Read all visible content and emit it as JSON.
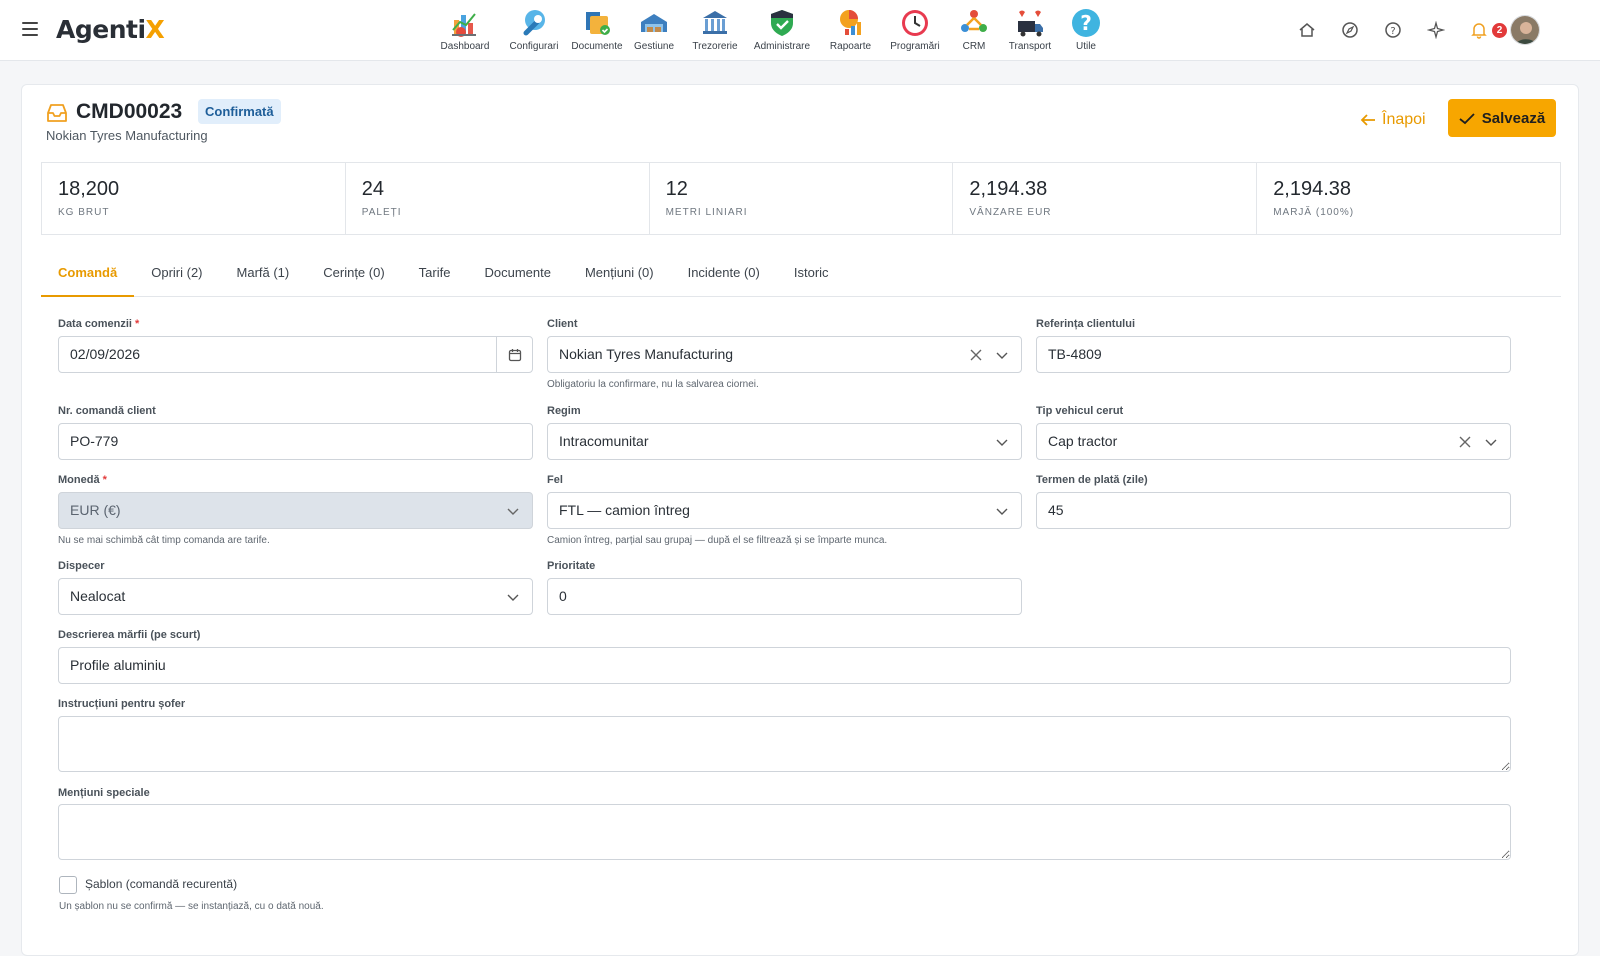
{
  "app": {
    "logo_main": "Agenti",
    "logo_accent": "X",
    "notifications_count": "2"
  },
  "nav": [
    {
      "label": "Dashboard",
      "icon": "dashboard-icon"
    },
    {
      "label": "Configurari",
      "icon": "wrench-icon"
    },
    {
      "label": "Documente",
      "icon": "documents-icon"
    },
    {
      "label": "Gestiune",
      "icon": "warehouse-icon"
    },
    {
      "label": "Trezorerie",
      "icon": "bank-icon"
    },
    {
      "label": "Administrare",
      "icon": "shield-icon"
    },
    {
      "label": "Rapoarte",
      "icon": "report-icon"
    },
    {
      "label": "Programări",
      "icon": "clock-icon"
    },
    {
      "label": "CRM",
      "icon": "crm-icon"
    },
    {
      "label": "Transport",
      "icon": "truck-icon"
    },
    {
      "label": "Utile",
      "icon": "help-icon"
    }
  ],
  "header": {
    "order_number": "CMD00023",
    "status": "Confirmată",
    "client_name": "Nokian Tyres Manufacturing",
    "back_label": "Înapoi",
    "save_label": "Salvează"
  },
  "stats": [
    {
      "value": "18,200",
      "label": "KG BRUT"
    },
    {
      "value": "24",
      "label": "PALEȚI"
    },
    {
      "value": "12",
      "label": "METRI LINIARI"
    },
    {
      "value": "2,194.38",
      "label": "VÂNZARE EUR"
    },
    {
      "value": "2,194.38",
      "label": "MARJĂ (100%)"
    }
  ],
  "tabs": [
    {
      "label": "Comandă",
      "active": true
    },
    {
      "label": "Opriri (2)"
    },
    {
      "label": "Marfă (1)"
    },
    {
      "label": "Cerințe (0)"
    },
    {
      "label": "Tarife"
    },
    {
      "label": "Documente"
    },
    {
      "label": "Mențiuni (0)"
    },
    {
      "label": "Incidente (0)"
    },
    {
      "label": "Istoric"
    }
  ],
  "form": {
    "order_date": {
      "label": "Data comenzii",
      "value": "02/09/2026"
    },
    "client": {
      "label": "Client",
      "value": "Nokian Tyres Manufacturing",
      "hint": "Obligatoriu la confirmare, nu la salvarea ciornei."
    },
    "client_ref": {
      "label": "Referința clientului",
      "value": "TB-4809"
    },
    "client_order_no": {
      "label": "Nr. comandă client",
      "value": "PO-779"
    },
    "regime": {
      "label": "Regim",
      "value": "Intracomunitar"
    },
    "vehicle_type": {
      "label": "Tip vehicul cerut",
      "value": "Cap tractor"
    },
    "currency": {
      "label": "Monedă",
      "value": "EUR (€)",
      "hint": "Nu se mai schimbă cât timp comanda are tarife."
    },
    "kind": {
      "label": "Fel",
      "value": "FTL — camion întreg",
      "hint": "Camion întreg, parțial sau grupaj — după el se filtrează și se împarte munca."
    },
    "payment_term": {
      "label": "Termen de plată (zile)",
      "value": "45"
    },
    "dispatcher": {
      "label": "Dispecer",
      "value": "Nealocat"
    },
    "priority": {
      "label": "Prioritate",
      "value": "0"
    },
    "goods_desc": {
      "label": "Descrierea mărfii (pe scurt)",
      "value": "Profile aluminiu"
    },
    "driver_instr": {
      "label": "Instrucțiuni pentru șofer",
      "value": ""
    },
    "special_notes": {
      "label": "Mențiuni speciale",
      "value": ""
    },
    "template": {
      "label": "Șablon (comandă recurentă)",
      "hint": "Un șablon nu se confirmă — se instanțiază, cu o dată nouă.",
      "checked": false
    },
    "required_mark": "*"
  },
  "colors": {
    "accent": "#f7a600",
    "status_bg": "#e1eefb",
    "status_text": "#1e5e99",
    "badge": "#e23a3a"
  }
}
